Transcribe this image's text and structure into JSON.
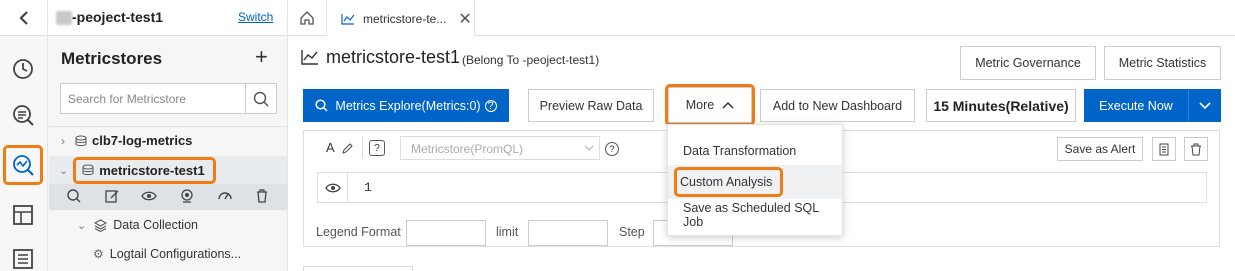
{
  "topbar": {
    "project_name": "-peoject-test1",
    "switch_label": "Switch",
    "tab_label": "metricstore-te..."
  },
  "sidebar": {
    "title": "Metricstores",
    "search_placeholder": "Search for Metricstore",
    "items": [
      {
        "label": "clb7-log-metrics"
      },
      {
        "label": "metricstore-test1"
      }
    ],
    "data_collection_label": "Data Collection",
    "logtail_label": "Logtail Configurations..."
  },
  "main": {
    "title": "metricstore-test1",
    "subtitle": "(Belong To  -peoject-test1)",
    "metric_governance": "Metric Governance",
    "metric_statistics": "Metric Statistics",
    "metrics_explore": "Metrics Explore(Metrics:0)",
    "preview_raw_data": "Preview Raw Data",
    "more": "More",
    "add_to_dashboard": "Add to New Dashboard",
    "time_range": "15 Minutes(Relative)",
    "execute_now": "Execute Now",
    "metricstore_select_placeholder": "Metricstore(PromQL)",
    "save_as_alert": "Save as Alert",
    "line_number": "1",
    "legend_format_label": "Legend Format",
    "limit_label": "limit",
    "step_label": "Step"
  },
  "more_menu": {
    "items": [
      {
        "label": "Data Transformation"
      },
      {
        "label": "Custom Analysis"
      },
      {
        "label": "Save as Scheduled SQL Job"
      }
    ]
  },
  "colors": {
    "accent": "#0064c8",
    "highlight": "#f07c13"
  }
}
